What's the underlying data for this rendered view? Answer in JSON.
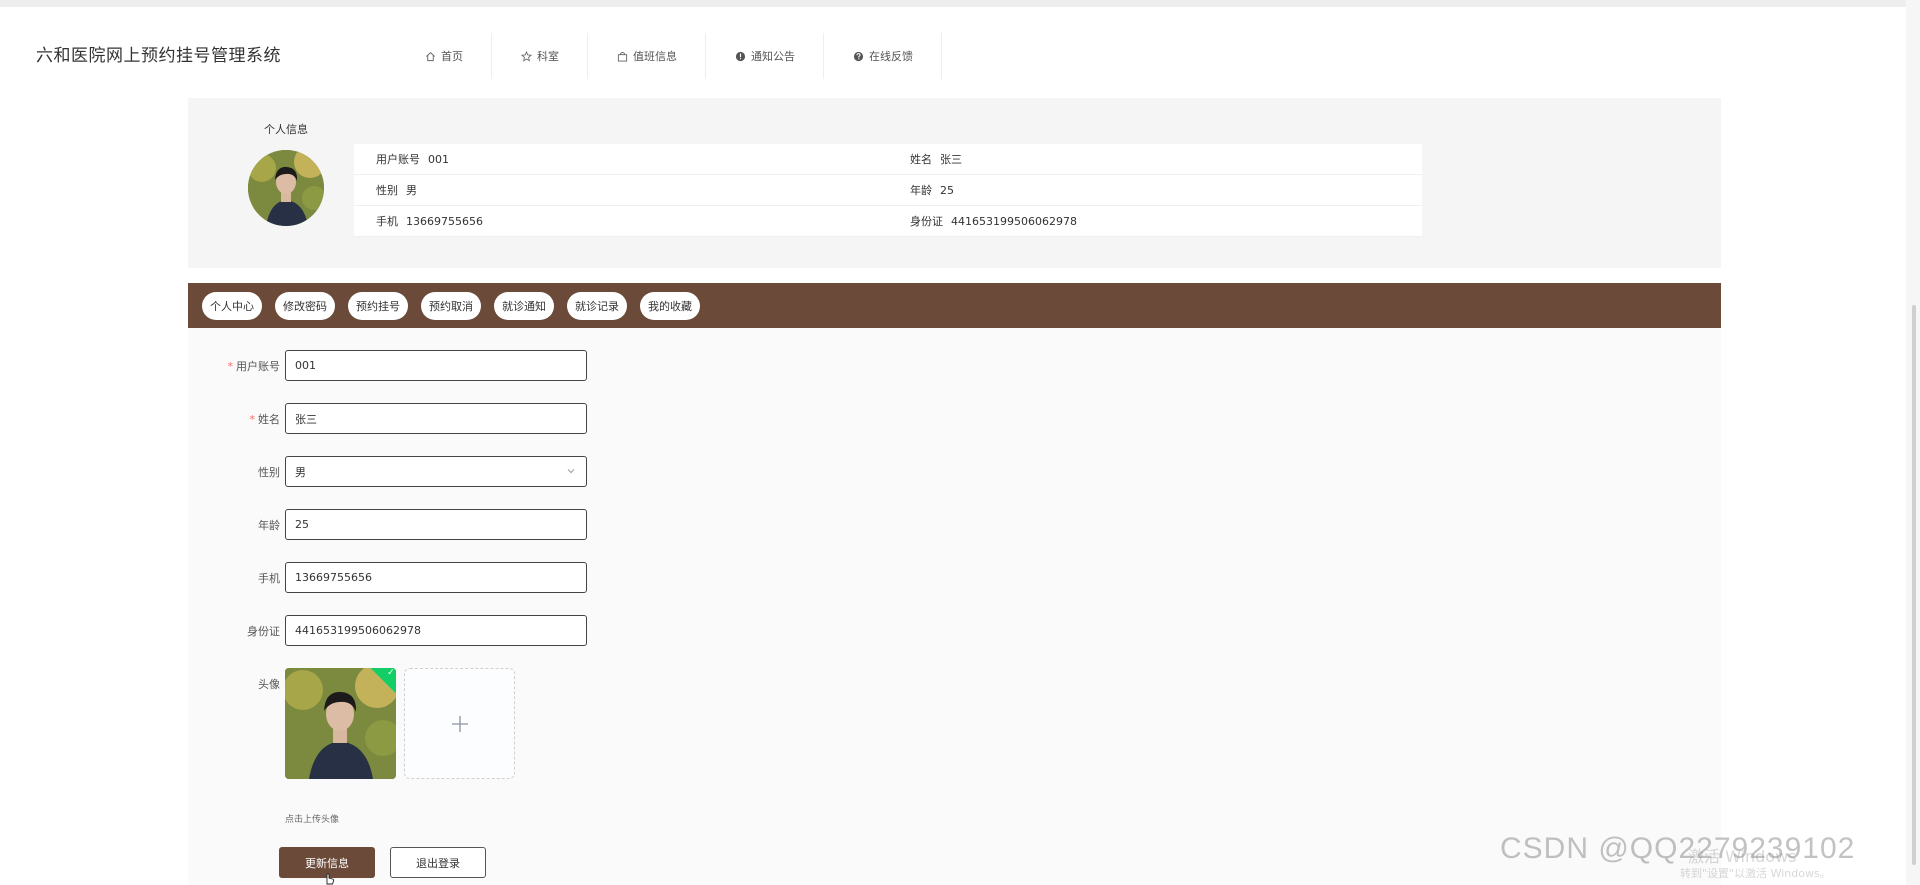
{
  "site": {
    "title": "六和医院网上预约挂号管理系统"
  },
  "nav": [
    {
      "label": "首页",
      "icon": "home-icon"
    },
    {
      "label": "科室",
      "icon": "star-icon"
    },
    {
      "label": "值班信息",
      "icon": "bag-icon"
    },
    {
      "label": "通知公告",
      "icon": "info-icon"
    },
    {
      "label": "在线反馈",
      "icon": "question-icon"
    }
  ],
  "profile": {
    "label": "个人信息",
    "rows": [
      [
        {
          "k": "用户账号",
          "v": "001"
        },
        {
          "k": "姓名",
          "v": "张三"
        }
      ],
      [
        {
          "k": "性别",
          "v": "男"
        },
        {
          "k": "年龄",
          "v": "25"
        }
      ],
      [
        {
          "k": "手机",
          "v": "13669755656"
        },
        {
          "k": "身份证",
          "v": "441653199506062978"
        }
      ]
    ]
  },
  "tabs": [
    "个人中心",
    "修改密码",
    "预约挂号",
    "预约取消",
    "就诊通知",
    "就诊记录",
    "我的收藏"
  ],
  "form": {
    "account": {
      "label": "用户账号",
      "value": "001"
    },
    "name": {
      "label": "姓名",
      "value": "张三"
    },
    "gender": {
      "label": "性别",
      "value": "男"
    },
    "age": {
      "label": "年龄",
      "value": "25"
    },
    "phone": {
      "label": "手机",
      "value": "13669755656"
    },
    "idcard": {
      "label": "身份证",
      "value": "441653199506062978"
    },
    "avatar": {
      "label": "头像",
      "hint": "点击上传头像"
    }
  },
  "buttons": {
    "update": "更新信息",
    "logout": "退出登录"
  },
  "overlay": {
    "watermark": "CSDN @QQ2279239102",
    "windows_title": "激活 Windows",
    "windows_sub": "转到\"设置\"以激活 Windows。"
  },
  "colors": {
    "brand": "#6b4a3a",
    "success": "#13ce66",
    "required": "#f56c6c"
  }
}
